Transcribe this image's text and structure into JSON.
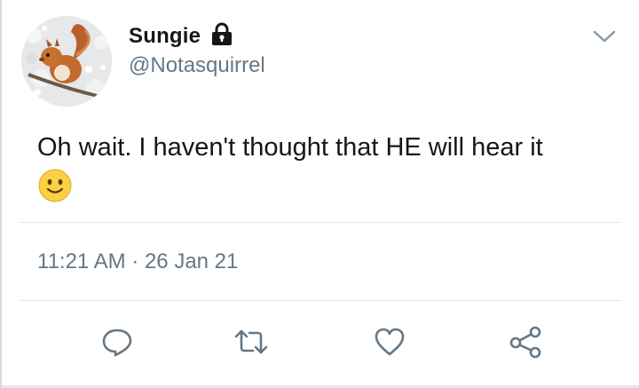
{
  "author": {
    "display_name": "Sungie",
    "handle": "@Notasquirrel",
    "protected_icon": "lock-icon",
    "avatar_subject": "red squirrel on a branch"
  },
  "menu": {
    "icon": "chevron-down-icon"
  },
  "tweet": {
    "text": "Oh wait. I haven't thought that HE will hear it",
    "emoji": "slightly-smiling-face",
    "timestamp": "11:21 AM · 26 Jan 21"
  },
  "actions": [
    {
      "name": "reply",
      "icon": "comment-icon"
    },
    {
      "name": "retweet",
      "icon": "retweet-icon"
    },
    {
      "name": "like",
      "icon": "heart-icon"
    },
    {
      "name": "share",
      "icon": "share-icon"
    }
  ],
  "colors": {
    "text_primary": "#14171a",
    "text_secondary": "#657786",
    "icon": "#657786",
    "divider": "#e1e8ed"
  }
}
